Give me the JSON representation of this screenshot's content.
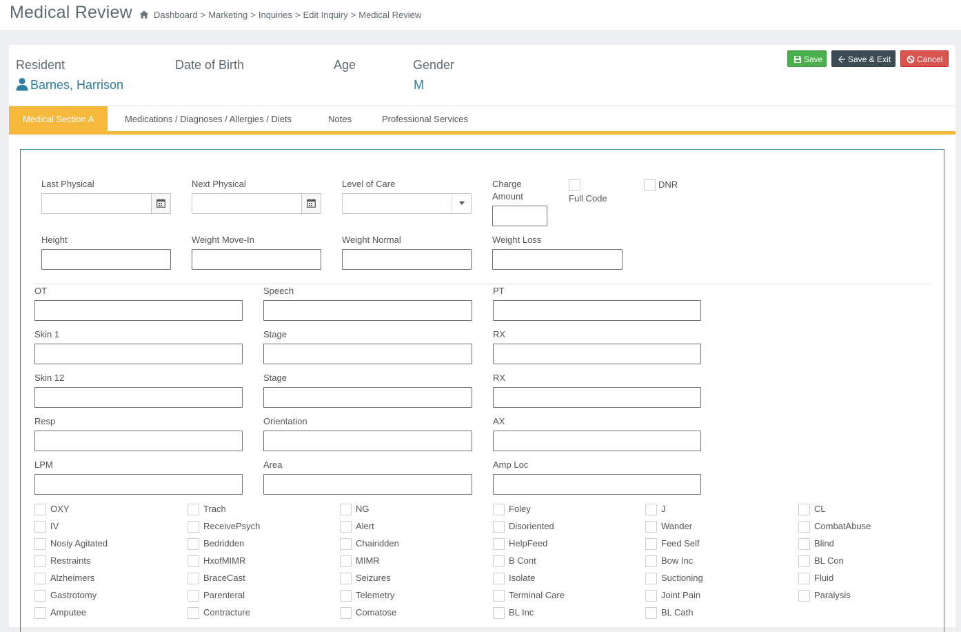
{
  "header": {
    "title": "Medical Review",
    "breadcrumb": [
      "Dashboard",
      "Marketing",
      "Inquiries",
      "Edit Inquiry",
      "Medical Review"
    ],
    "separator": ">"
  },
  "resident": {
    "resident_label": "Resident",
    "resident_name": "Barnes, Harrison",
    "dob_label": "Date of Birth",
    "dob_value": "",
    "age_label": "Age",
    "age_value": "",
    "gender_label": "Gender",
    "gender_value": "M"
  },
  "actions": {
    "save": "Save",
    "save_exit": "Save & Exit",
    "cancel": "Cancel"
  },
  "colors": {
    "accent": "#f6b83a",
    "link": "#2c7da0",
    "save": "#4cae4c",
    "save_exit": "#3d4b55",
    "cancel": "#d9534f",
    "panel_border": "#2b8696"
  },
  "tabs": [
    {
      "label": "Medical Section A",
      "active": true
    },
    {
      "label": "Medications / Diagnoses / Allergies / Diets",
      "active": false
    },
    {
      "label": "Notes",
      "active": false
    },
    {
      "label": "Professional Services",
      "active": false
    }
  ],
  "form": {
    "last_physical": "Last Physical",
    "next_physical": "Next Physical",
    "level_of_care": "Level of Care",
    "charge_amount_1": "Charge",
    "charge_amount_2": "Amount",
    "full_code": "Full Code",
    "dnr": "DNR",
    "height": "Height",
    "weight_move_in": "Weight Move-In",
    "weight_normal": "Weight Normal",
    "weight_loss": "Weight Loss",
    "ot": "OT",
    "speech": "Speech",
    "pt": "PT",
    "skin1": "Skin 1",
    "stage1": "Stage",
    "rx1": "RX",
    "skin12": "Skin 12",
    "stage2": "Stage",
    "rx2": "RX",
    "resp": "Resp",
    "orientation": "Orientation",
    "ax": "AX",
    "lpm": "LPM",
    "area": "Area",
    "amp_loc": "Amp Loc"
  },
  "checkbox_columns": [
    [
      "OXY",
      "IV",
      "Nosiy Agitated",
      "Restraints",
      "Alzheimers",
      "Gastrotomy",
      "Amputee"
    ],
    [
      "Trach",
      "ReceivePsych",
      "Bedridden",
      "HxofMIMR",
      "BraceCast",
      "Parenteral",
      "Contracture"
    ],
    [
      "NG",
      "Alert",
      "Chairidden",
      "MIMR",
      "Seizures",
      "Telemetry",
      "Comatose"
    ],
    [
      "Foley",
      "Disoriented",
      "HelpFeed",
      "B Cont",
      "Isolate",
      "Terminal Care",
      "BL Inc"
    ],
    [
      "J",
      "Wander",
      "Feed Self",
      "Bow Inc",
      "Suctioning",
      "Joint Pain",
      "BL Cath"
    ],
    [
      "CL",
      "CombatAbuse",
      "Blind",
      "BL Con",
      "Fluid",
      "Paralysis"
    ]
  ]
}
